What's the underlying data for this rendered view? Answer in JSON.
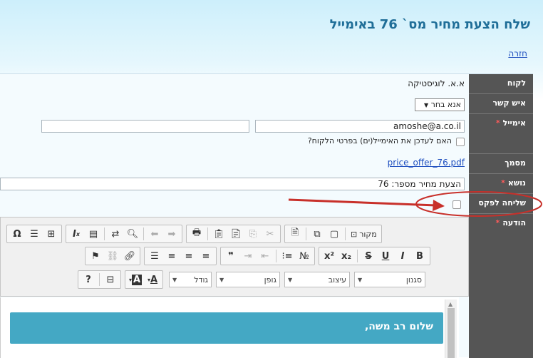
{
  "page": {
    "title": "שלח הצעת מחיר מס` 76 באימייל",
    "back_link": "חזרה"
  },
  "labels": {
    "customer": "לקוח",
    "contact": "איש קשר",
    "email": "אימייל",
    "document": "מסמך",
    "subject": "נושא",
    "fax": "שליחה לפקס",
    "message": "הודעה",
    "required_mark": "*"
  },
  "fields": {
    "customer_name": "א.א. לוגיסטיקה",
    "contact_select": "אנא בחר",
    "email_value": "amoshe@a.co.il",
    "email_cc_value": "",
    "update_email_label": "האם לעדכן את האימייל(ים) בפרטי הלקוח?",
    "pdf_file": "price_offer_76.pdf",
    "subject_value": "הצעת מחיר מספר: 76"
  },
  "toolbar": {
    "source_label": "מקור",
    "style_label": "סגנון",
    "format_label": "עיצוב",
    "font_label": "גופן",
    "size_label": "גודל"
  },
  "editor": {
    "greeting": "שלום רב משה,"
  },
  "colors": {
    "title": "#1f6e98",
    "label_column": "#555555",
    "greeting_band": "#44a8c4",
    "annotation": "#c8302a"
  }
}
